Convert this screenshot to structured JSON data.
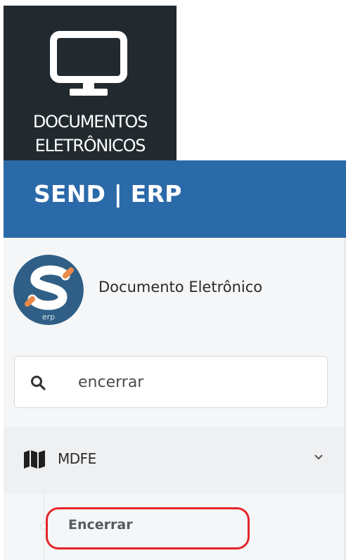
{
  "tile": {
    "icon": "monitor-icon",
    "label_line1": "DOCUMENTOS",
    "label_line2": "ELETRÔNICOS",
    "background": "#222a2f"
  },
  "header": {
    "brand": "SEND | ERP",
    "background": "#2b6aa9"
  },
  "sidebar": {
    "logo": {
      "icon": "send-erp-logo",
      "letter": "S",
      "caption": "erp"
    },
    "app_title": "Documento Eletrônico",
    "search": {
      "icon": "search-icon",
      "value": "encerrar"
    },
    "menu": {
      "group_label": "MDFE",
      "group_icon": "map-icon",
      "expanded_icon": "chevron-down-icon",
      "items": [
        {
          "label": "Encerrar",
          "highlighted": true
        }
      ]
    }
  },
  "colors": {
    "highlight_outline": "#e3262b",
    "logo_orange": "#e98a4a",
    "logo_blue": "#2f5f86"
  }
}
